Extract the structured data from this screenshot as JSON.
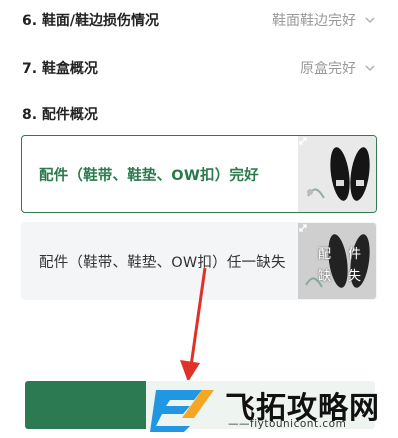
{
  "items": [
    {
      "label": "6. 鞋面/鞋边损伤情况",
      "value": "鞋面鞋边完好"
    },
    {
      "label": "7. 鞋盒概况",
      "value": "原盒完好"
    }
  ],
  "section8": {
    "label": "8. 配件概况",
    "options": [
      {
        "text": "配件（鞋带、鞋垫、OW扣）完好",
        "selected": true
      },
      {
        "text": "配件（鞋带、鞋垫、OW扣）任一缺失",
        "selected": false,
        "thumb_overlay": [
          "配",
          "件",
          "缺",
          "失"
        ]
      }
    ]
  },
  "watermark": {
    "title": "飞拓攻略网",
    "url": "——fiytounicont.com"
  },
  "colors": {
    "accent": "#2b7a52",
    "arrow": "#e0302a"
  },
  "icons": {
    "dropdown": "chevron-down-icon",
    "expand": "expand-icon"
  }
}
